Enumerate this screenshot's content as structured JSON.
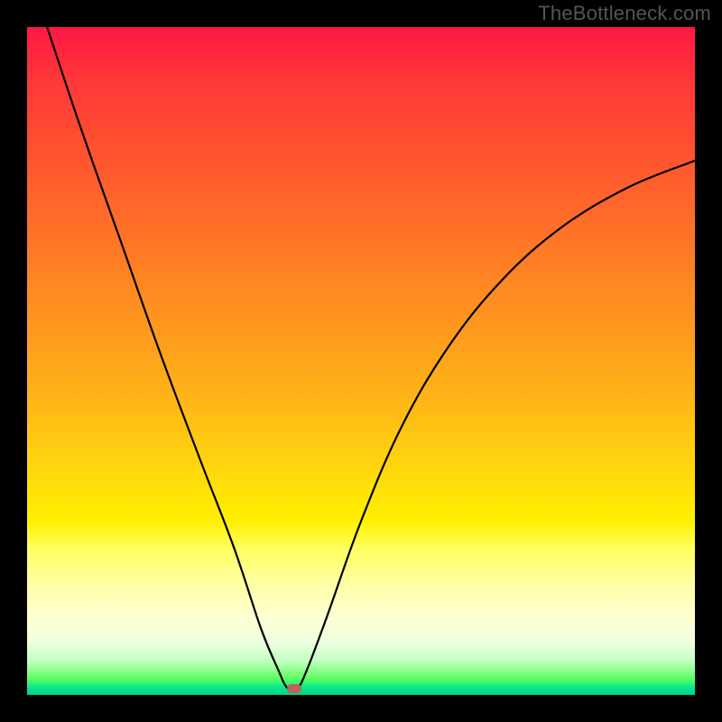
{
  "watermark": "TheBottleneck.com",
  "chart_data": {
    "type": "line",
    "title": "",
    "xlabel": "",
    "ylabel": "",
    "xlim": [
      0,
      100
    ],
    "ylim": [
      0,
      100
    ],
    "curve": {
      "description": "V-shaped bottleneck curve with minimum near x≈39",
      "points": [
        {
          "x": 3,
          "y": 100
        },
        {
          "x": 8,
          "y": 85
        },
        {
          "x": 14,
          "y": 68
        },
        {
          "x": 20,
          "y": 51
        },
        {
          "x": 26,
          "y": 35
        },
        {
          "x": 31,
          "y": 22
        },
        {
          "x": 35,
          "y": 10
        },
        {
          "x": 37.5,
          "y": 4
        },
        {
          "x": 39,
          "y": 1
        },
        {
          "x": 40.5,
          "y": 1
        },
        {
          "x": 42,
          "y": 4
        },
        {
          "x": 45,
          "y": 12
        },
        {
          "x": 50,
          "y": 26
        },
        {
          "x": 56,
          "y": 40
        },
        {
          "x": 63,
          "y": 52
        },
        {
          "x": 71,
          "y": 62
        },
        {
          "x": 80,
          "y": 70
        },
        {
          "x": 90,
          "y": 76
        },
        {
          "x": 100,
          "y": 80
        }
      ]
    },
    "marker": {
      "x": 40,
      "y": 1,
      "color": "#c0605a"
    },
    "background_gradient": {
      "top": "#ff1744",
      "mid": "#ffd010",
      "bottom": "#00d080"
    }
  }
}
